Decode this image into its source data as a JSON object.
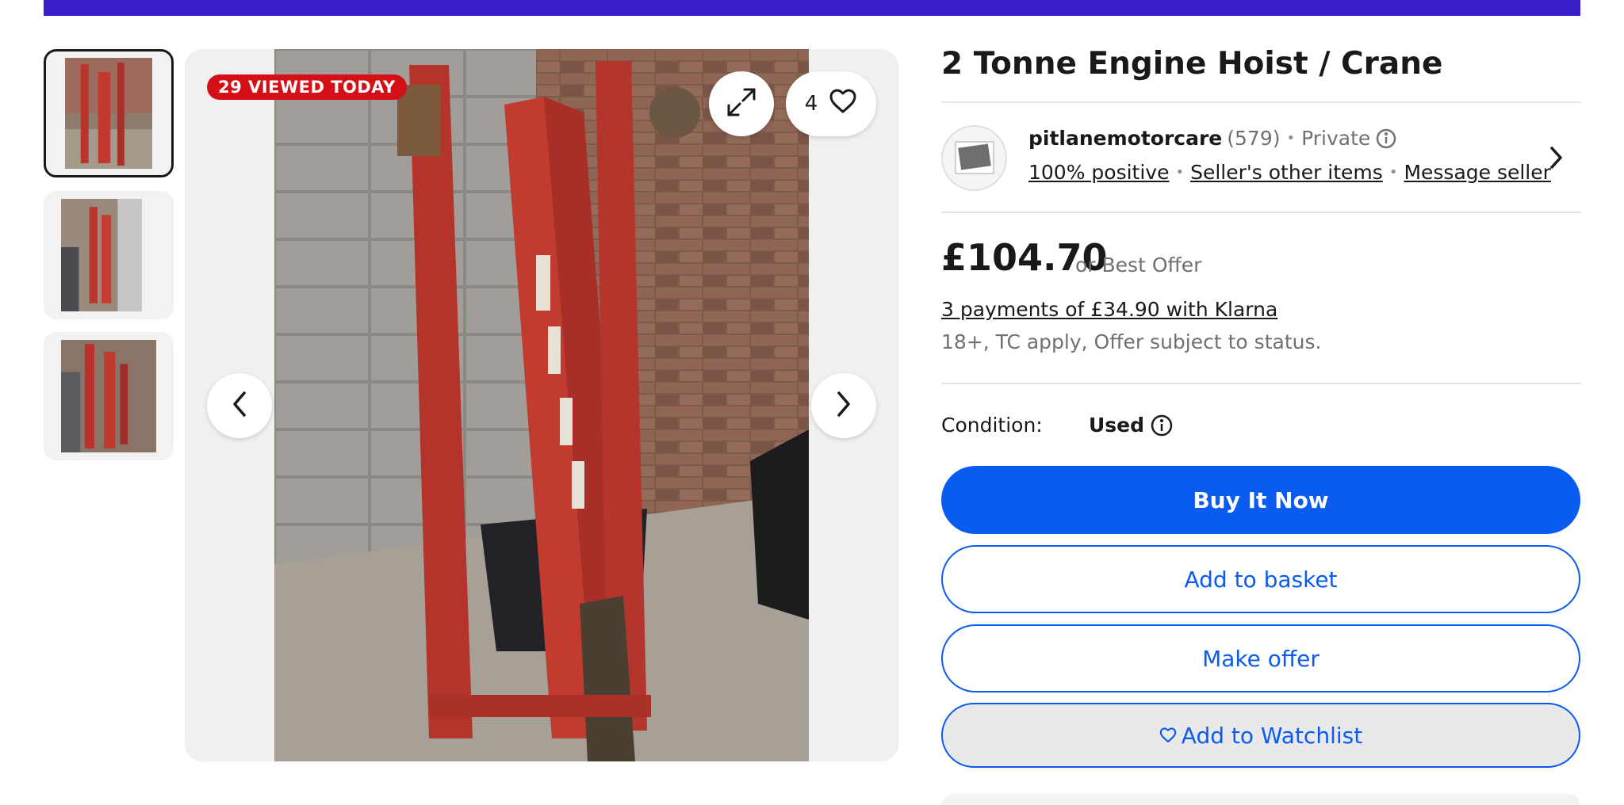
{
  "gallery": {
    "badge": "29 VIEWED TODAY",
    "watch_count": "4",
    "thumbnails": [
      "thumbnail-1",
      "thumbnail-2",
      "thumbnail-3"
    ]
  },
  "listing": {
    "title": "2 Tonne Engine Hoist / Crane"
  },
  "seller": {
    "name": "pitlanemotorcare",
    "feedback_count": "(579)",
    "type": "Private",
    "positive": "100% positive",
    "other_items": "Seller's other items",
    "message": "Message seller"
  },
  "pricing": {
    "price": "£104.70",
    "best_offer": "or Best Offer",
    "klarna": "3 payments of £34.90 with Klarna",
    "terms": "18+, TC apply, Offer subject to status."
  },
  "condition": {
    "label": "Condition:",
    "value": "Used"
  },
  "actions": {
    "buy_now": "Buy It Now",
    "add_to_basket": "Add to basket",
    "make_offer": "Make offer",
    "watchlist": "Add to Watchlist"
  },
  "colors": {
    "accent": "#0a5bf0",
    "badge": "#d40f16",
    "top_bar": "#3b1ec8"
  }
}
